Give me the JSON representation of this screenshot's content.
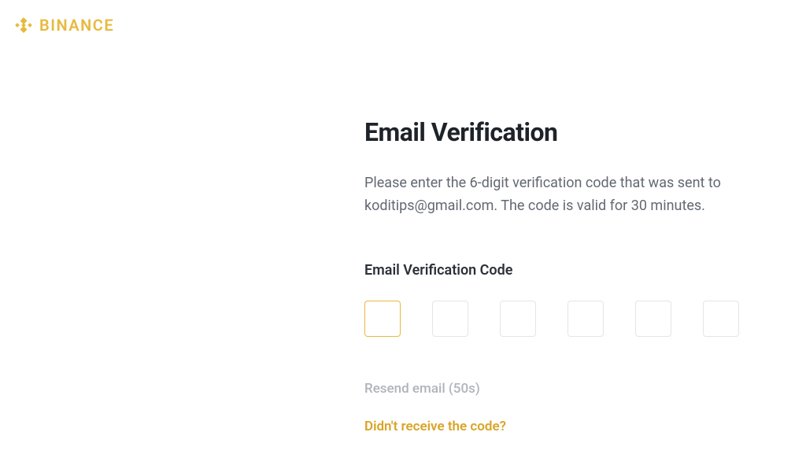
{
  "header": {
    "brand_text": "BINANCE"
  },
  "verification": {
    "title": "Email Verification",
    "description": "Please enter the 6-digit verification code that was sent to koditips@gmail.com. The code is valid for 30 minutes.",
    "field_label": "Email Verification Code",
    "code_values": [
      "",
      "",
      "",
      "",
      "",
      ""
    ],
    "active_index": 0,
    "resend_text": "Resend email (50s)",
    "help_link_text": "Didn't receive the code?"
  },
  "colors": {
    "brand": "#e8b93e",
    "accent": "#d9a427",
    "text_primary": "#1e2329",
    "text_secondary": "#626872",
    "text_muted": "#aeb4bc"
  }
}
